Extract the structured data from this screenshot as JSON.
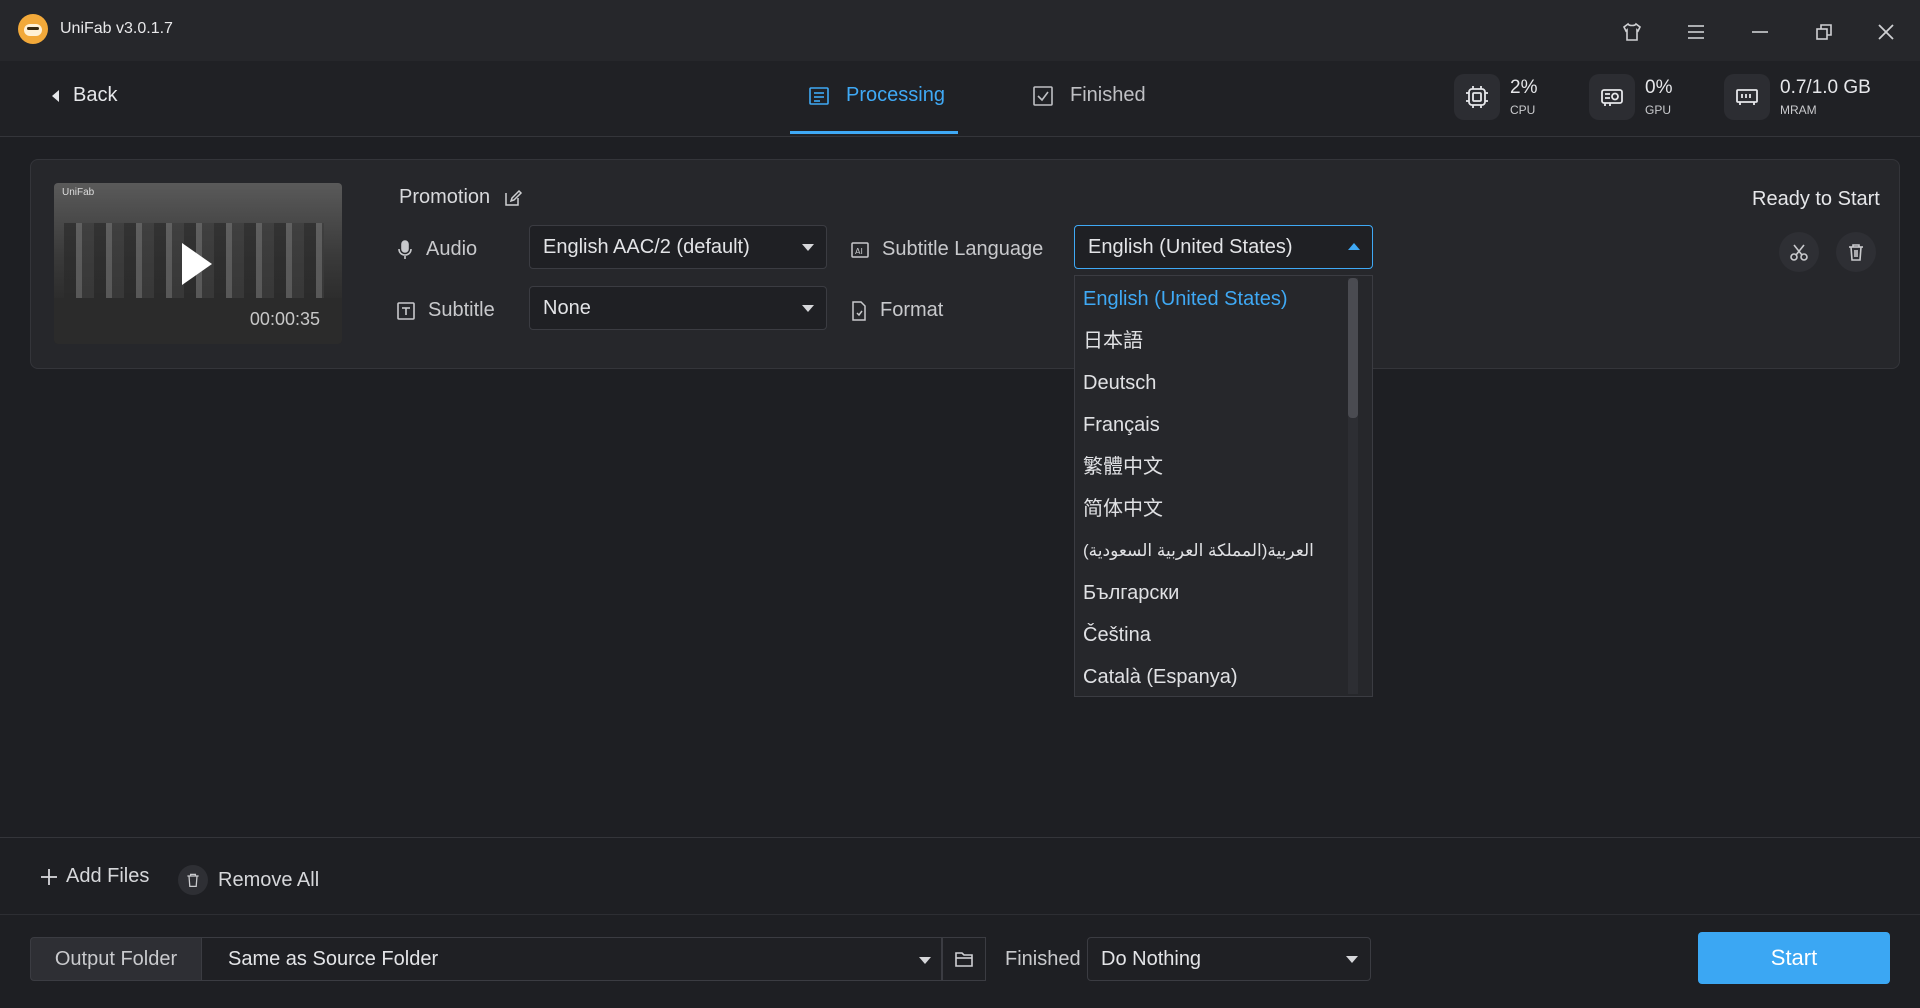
{
  "window": {
    "title": "UniFab v3.0.1.7"
  },
  "nav": {
    "back_label": "Back",
    "tabs": [
      {
        "label": "Processing",
        "active": true
      },
      {
        "label": "Finished",
        "active": false
      }
    ],
    "stats": [
      {
        "value": "2%",
        "label": "CPU",
        "icon": "cpu-icon"
      },
      {
        "value": "0%",
        "label": "GPU",
        "icon": "gpu-icon"
      },
      {
        "value": "0.7/1.0 GB",
        "label": "MRAM",
        "icon": "memory-icon"
      }
    ]
  },
  "task": {
    "thumb_brand": "UniFab",
    "duration": "00:00:35",
    "name": "Promotion",
    "audio_label": "Audio",
    "audio_value": "English AAC/2 (default)",
    "subtitle_label": "Subtitle",
    "subtitle_value": "None",
    "subtitle_language_label": "Subtitle Language",
    "subtitle_language_value": "English (United States)",
    "format_label": "Format",
    "status": "Ready to Start"
  },
  "dropdown": {
    "options": [
      "English (United States)",
      "日本語",
      "Deutsch",
      "Français",
      "繁體中文",
      "简体中文",
      "العربية(المملكة العربية السعودية)",
      "Български",
      "Čeština",
      "Català (Espanya)"
    ],
    "selected_index": 0
  },
  "bottom": {
    "add_files": "Add Files",
    "remove_all": "Remove All",
    "output_folder_label": "Output Folder",
    "output_folder_value": "Same as Source Folder",
    "finished_label": "Finished",
    "finished_value": "Do Nothing",
    "start_label": "Start"
  },
  "colors": {
    "accent": "#3fa9f5",
    "background": "#1e1f23",
    "panel": "#26272b"
  }
}
